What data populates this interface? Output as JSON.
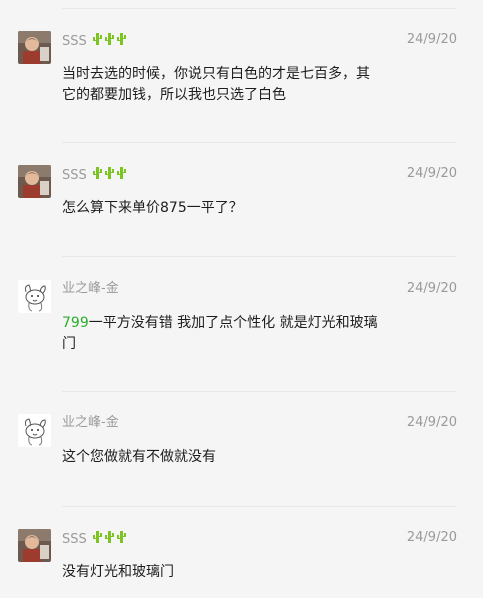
{
  "colors": {
    "background": "#f5f5f5",
    "link_green": "#2aae2a",
    "meta_gray": "#9a9a9a",
    "text": "#1d1d1d"
  },
  "comments": [
    {
      "author": "SSS",
      "author_badge": "cactus-icon ×3",
      "avatar": "photo-avatar",
      "date": "24/9/20",
      "text": "当时去选的时候，你说只有白色的才是七百多，其它的都要加钱，所以我也只选了白色"
    },
    {
      "author": "SSS",
      "author_badge": "cactus-icon ×3",
      "avatar": "photo-avatar",
      "date": "24/9/20",
      "text": "怎么算下来单价875一平了？"
    },
    {
      "author": "业之峰-金",
      "avatar": "sketch-avatar",
      "date": "24/9/20",
      "highlight": "799",
      "text": "一平方没有错 我加了点个性化 就是灯光和玻璃门"
    },
    {
      "author": "业之峰-金",
      "avatar": "sketch-avatar",
      "date": "24/9/20",
      "text": "这个您做就有不做就没有"
    },
    {
      "author": "SSS",
      "author_badge": "cactus-icon ×3",
      "avatar": "photo-avatar",
      "date": "24/9/20",
      "text": "没有灯光和玻璃门"
    }
  ]
}
